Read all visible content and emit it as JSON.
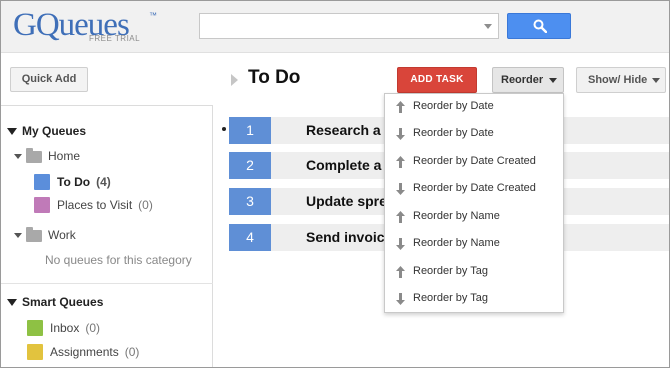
{
  "app": {
    "logo_text": "GQueues",
    "logo_tm": "™",
    "logo_sub": "FREE TRIAL"
  },
  "search": {
    "value": "",
    "placeholder": ""
  },
  "sidebar": {
    "quick_add_label": "Quick Add",
    "my_queues_title": "My Queues",
    "categories": [
      {
        "name": "Home",
        "queues": [
          {
            "label": "To Do",
            "count": "(4)",
            "color": "#5b8edb",
            "selected": true
          },
          {
            "label": "Places to Visit",
            "count": "(0)",
            "color": "#c07ab8",
            "selected": false
          }
        ]
      },
      {
        "name": "Work",
        "empty_text": "No queues for this category"
      }
    ],
    "smart_queues_title": "Smart Queues",
    "smart_queues": [
      {
        "label": "Inbox",
        "count": "(0)",
        "color": "#8ec144"
      },
      {
        "label": "Assignments",
        "count": "(0)",
        "color": "#e2c33e"
      }
    ]
  },
  "main": {
    "title": "To Do",
    "add_task_label": "ADD TASK",
    "reorder_label": "Reorder",
    "show_hide_label": "Show/ Hide",
    "tasks": [
      {
        "num": "1",
        "text": "Research a"
      },
      {
        "num": "2",
        "text": "Complete a"
      },
      {
        "num": "3",
        "text": "Update spre"
      },
      {
        "num": "4",
        "text": "Send invoic"
      }
    ]
  },
  "reorder_menu": [
    {
      "direction": "up",
      "icon": "arrow-up-icon",
      "label": "Reorder by Date"
    },
    {
      "direction": "down",
      "icon": "arrow-down-icon",
      "label": "Reorder by Date"
    },
    {
      "direction": "up",
      "icon": "arrow-up-icon",
      "label": "Reorder by Date Created"
    },
    {
      "direction": "down",
      "icon": "arrow-down-icon",
      "label": "Reorder by Date Created"
    },
    {
      "direction": "up",
      "icon": "arrow-up-icon",
      "label": "Reorder by Name"
    },
    {
      "direction": "down",
      "icon": "arrow-down-icon",
      "label": "Reorder by Name"
    },
    {
      "direction": "up",
      "icon": "arrow-up-icon",
      "label": "Reorder by Tag"
    },
    {
      "direction": "down",
      "icon": "arrow-down-icon",
      "label": "Reorder by Tag"
    }
  ],
  "colors": {
    "accent_blue": "#4d8ff0",
    "add_task_red": "#d9453a",
    "task_number_blue": "#5f8fd6"
  }
}
